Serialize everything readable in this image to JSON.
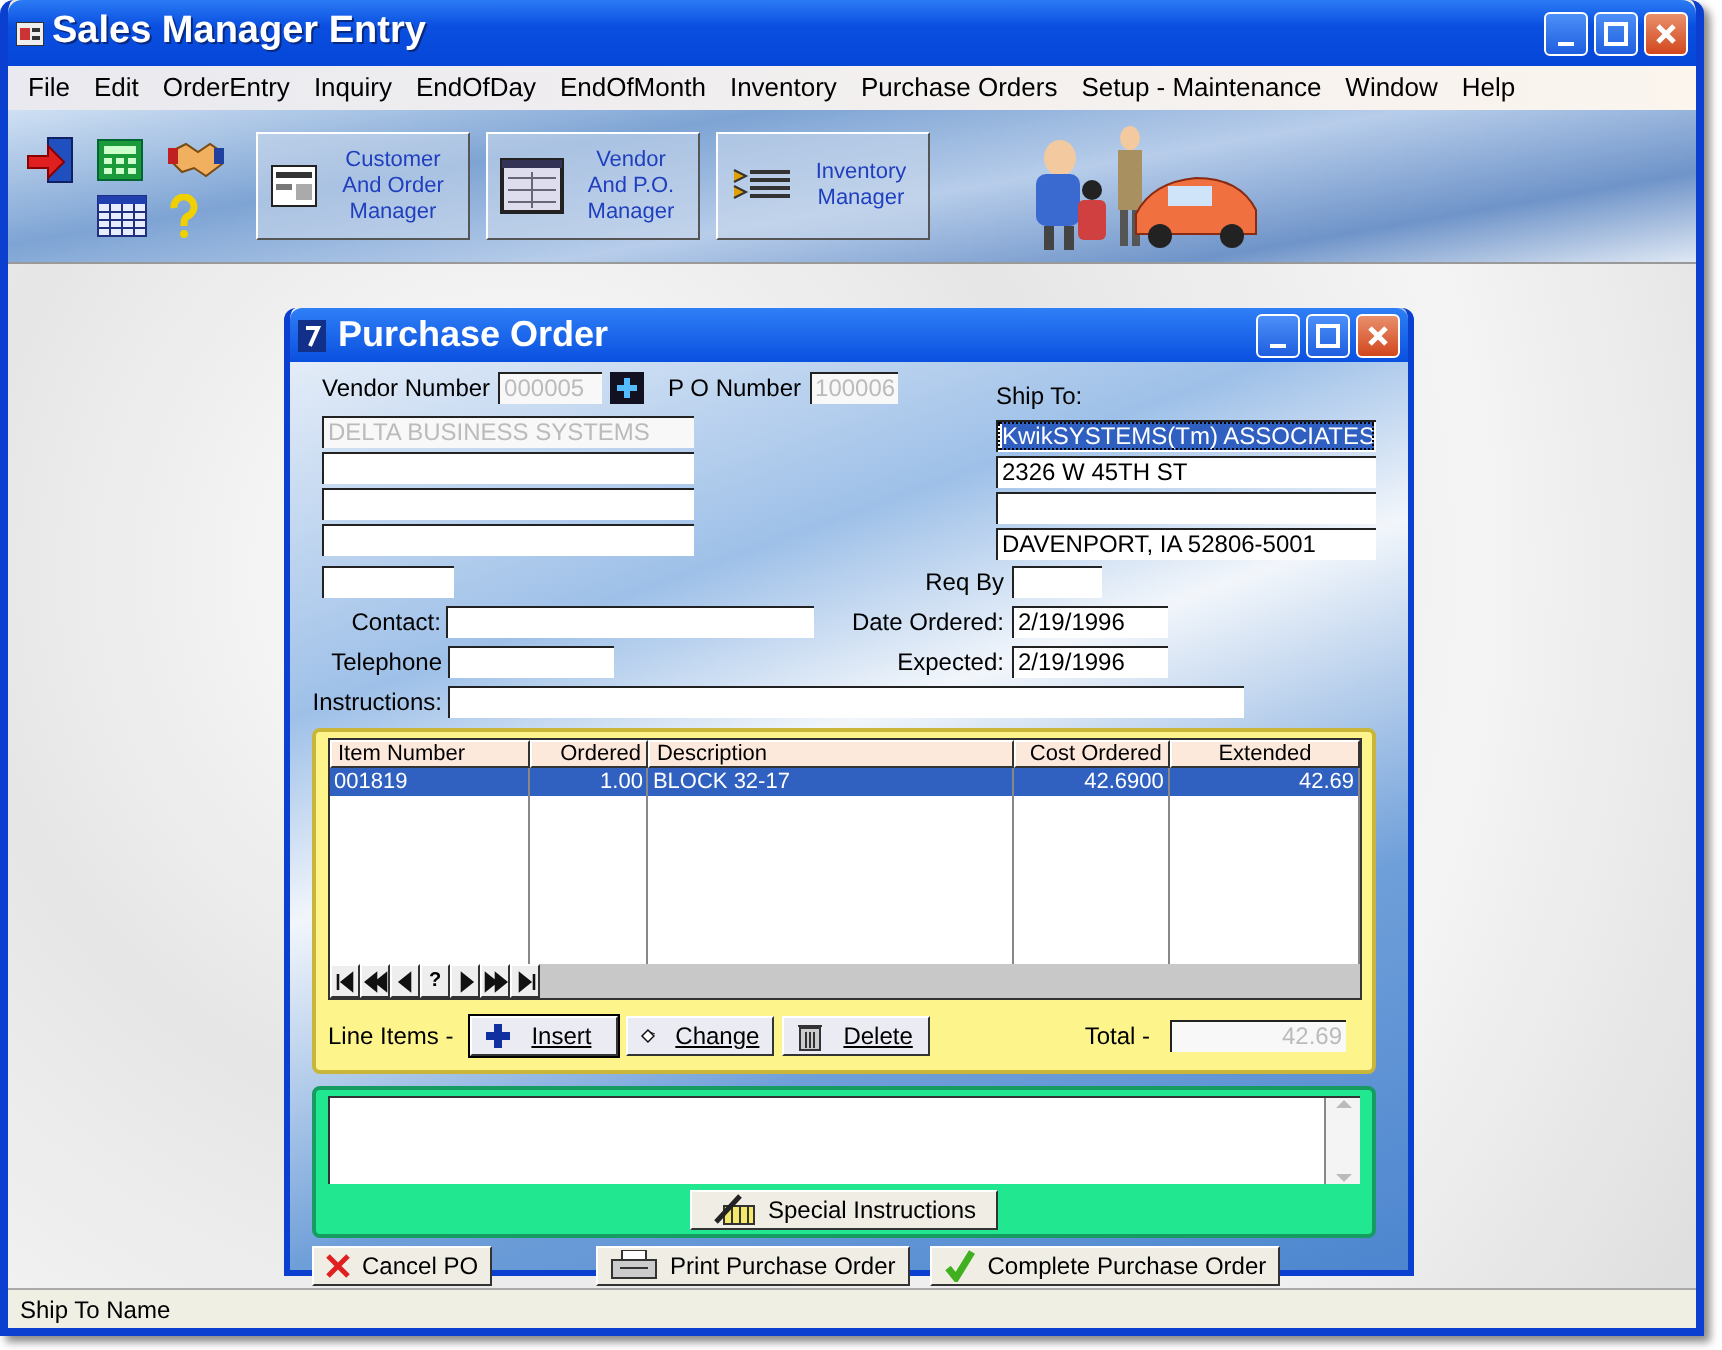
{
  "window": {
    "title": "Sales Manager Entry"
  },
  "menu": [
    "File",
    "Edit",
    "OrderEntry",
    "Inquiry",
    "EndOfDay",
    "EndOfMonth",
    "Inventory",
    "Purchase Orders",
    "Setup - Maintenance",
    "Window",
    "Help"
  ],
  "toolbar": {
    "manager_buttons": [
      {
        "kind": "customer",
        "lines": [
          "Customer",
          "And Order",
          "Manager"
        ]
      },
      {
        "kind": "vendor",
        "lines": [
          "Vendor",
          "And P.O.",
          "Manager"
        ]
      },
      {
        "kind": "inventory",
        "lines": [
          "Inventory",
          "Manager"
        ]
      }
    ]
  },
  "dialog": {
    "title": "Purchase Order",
    "vendor_number": {
      "label": "Vendor Number",
      "value": "000005",
      "disabled": true
    },
    "po_number": {
      "label": "P O Number",
      "value": "100006",
      "disabled": true
    },
    "vendor_name": {
      "value": "DELTA BUSINESS SYSTEMS",
      "disabled": true
    },
    "ship_to": {
      "label": "Ship To:",
      "lines": [
        {
          "value": "KwikSYSTEMS(Tm) ASSOCIATES",
          "selected": true
        },
        {
          "value": "2326 W 45TH ST",
          "selected": false
        },
        {
          "selected": false
        },
        {
          "value": "DAVENPORT, IA  52806-5001",
          "selected": false
        }
      ]
    },
    "req_by": {
      "label": "Req By"
    },
    "contact": {
      "label": "Contact:"
    },
    "date_ordered": {
      "label": "Date Ordered:",
      "value": "2/19/1996"
    },
    "telephone": {
      "label": "Telephone"
    },
    "expected": {
      "label": "Expected:",
      "value": "2/19/1996"
    },
    "instructions": {
      "label": "Instructions:"
    },
    "grid": {
      "columns": [
        {
          "label": "Item Number"
        },
        {
          "label": "Ordered"
        },
        {
          "label": "Description"
        },
        {
          "label": "Cost Ordered"
        },
        {
          "label": "Extended"
        }
      ],
      "rows": [
        {
          "cells": [
            "001819",
            "1.00",
            "BLOCK 32-17",
            "42.6900",
            "42.69"
          ],
          "selected": true
        }
      ],
      "help_button": "?"
    },
    "line_items_label": "Line Items -",
    "line_buttons": [
      {
        "kind": "insert",
        "label": "Insert",
        "default": true
      },
      {
        "kind": "change",
        "label": "Change",
        "default": false
      },
      {
        "kind": "delete",
        "label": "Delete",
        "default": false
      }
    ],
    "total": {
      "label": "Total -",
      "value": "42.69",
      "disabled": true
    },
    "special_instructions_button": "Special Instructions",
    "footer_buttons": [
      {
        "kind": "cancel",
        "label": "Cancel PO"
      },
      {
        "kind": "print",
        "label": "Print Purchase Order"
      },
      {
        "kind": "complete",
        "label": "Complete Purchase Order"
      }
    ]
  },
  "status_bar": "Ship To Name"
}
